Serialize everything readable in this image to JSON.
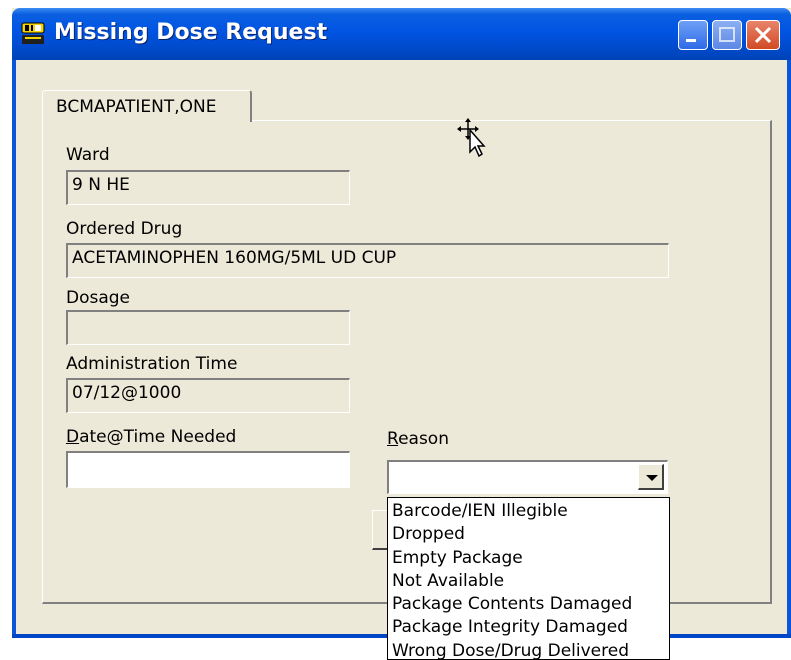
{
  "window": {
    "title": "Missing Dose Request"
  },
  "tabs": [
    {
      "label": "BCMAPATIENT,ONE"
    }
  ],
  "form": {
    "ward_label": "Ward",
    "ward_value": "9 N HE",
    "ordered_drug_label": "Ordered Drug",
    "ordered_drug_value": "ACETAMINOPHEN 160MG/5ML UD CUP",
    "dosage_label": "Dosage",
    "dosage_value": "",
    "admin_time_label": "Administration Time",
    "admin_time_value": "07/12@1000",
    "date_needed_label_first": "D",
    "date_needed_label_rest": "ate@Time Needed",
    "date_needed_value": "",
    "reason_label_first": "R",
    "reason_label_rest": "eason",
    "reason_value": ""
  },
  "reason_options": [
    "Barcode/IEN Illegible",
    "Dropped",
    "Empty Package",
    "Not Available",
    "Package Contents Damaged",
    "Package Integrity Damaged",
    "Wrong Dose/Drug Delivered"
  ],
  "colors": {
    "titlebar": "#0054e3",
    "window_bg": "#ece9d8",
    "close_button": "#d14b25"
  }
}
